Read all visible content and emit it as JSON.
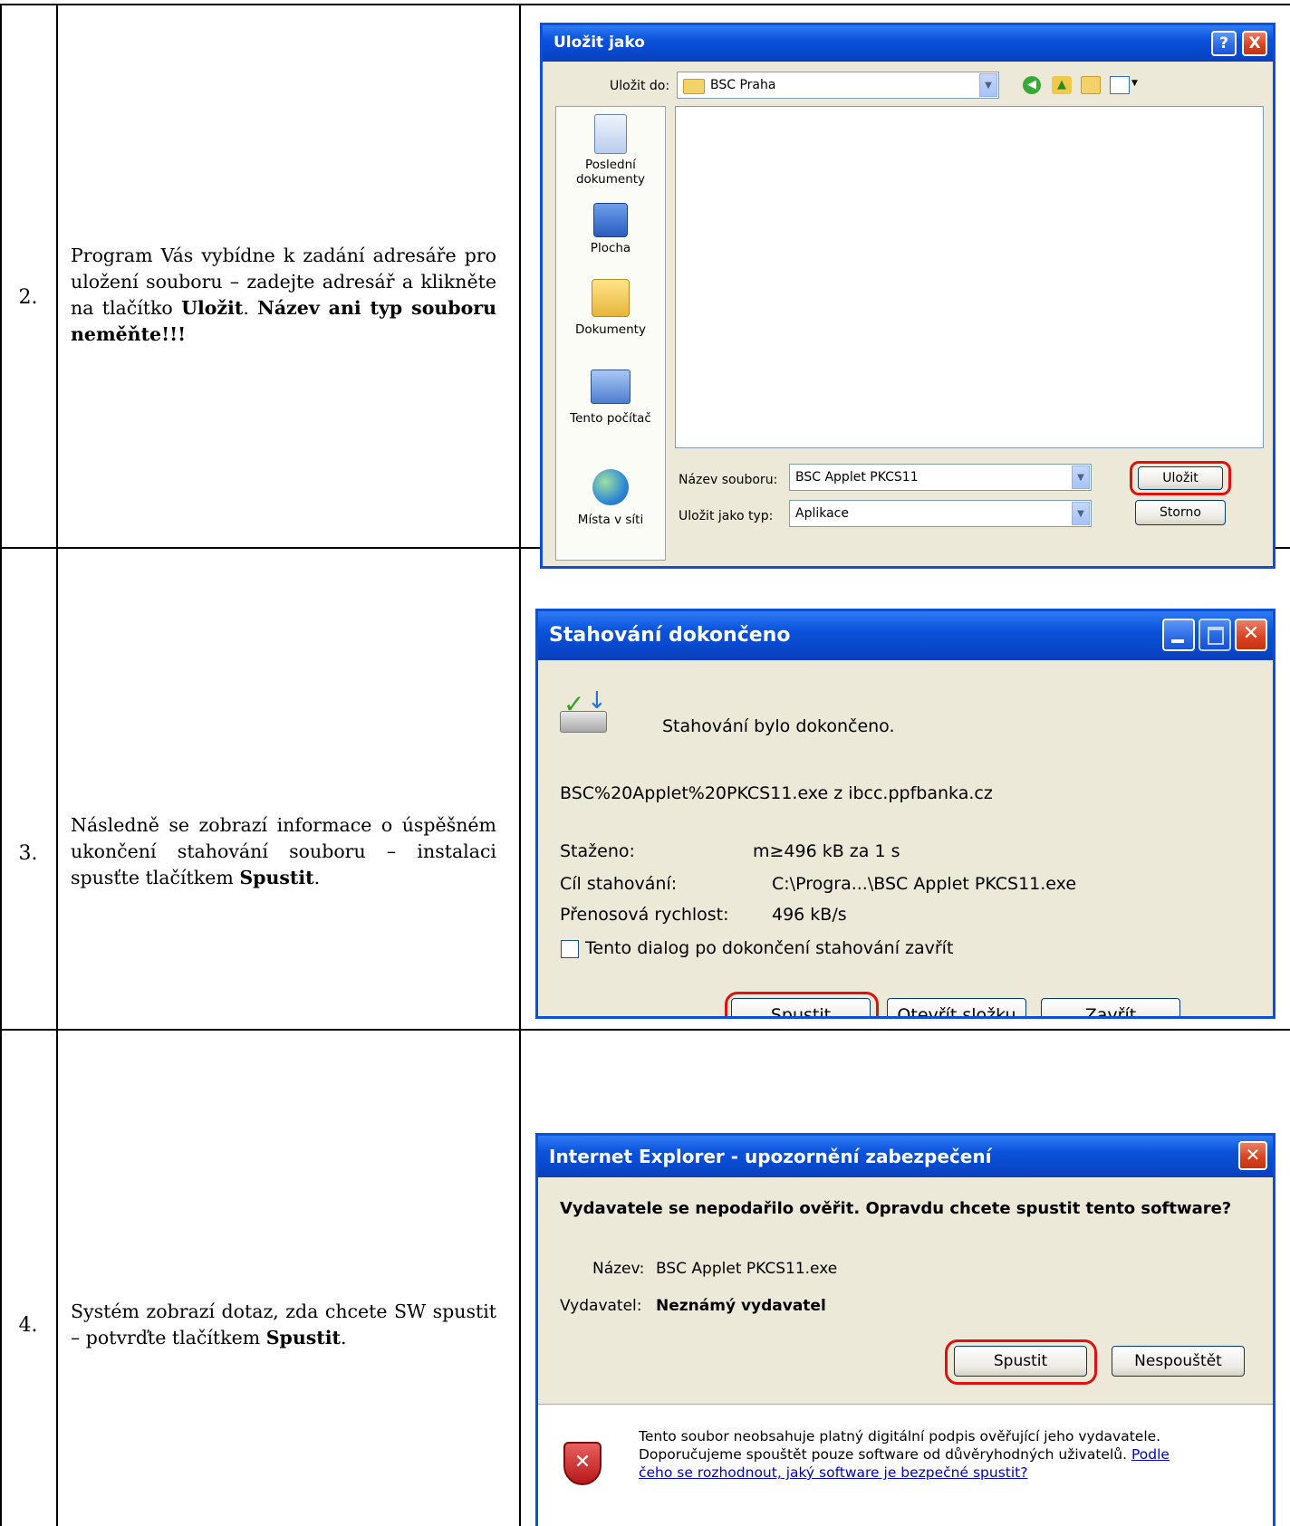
{
  "rows": [
    {
      "number": "2.",
      "text_plain": "Program Vás vybídne k zadání adresáře pro uložení souboru – zadejte adresář a klikněte na tlačítko",
      "text_bold1": "Uložit",
      "text_sep": ".",
      "text_bold2": "Název ani typ souboru neměňte!!!"
    },
    {
      "number": "3.",
      "text_plain": "Následně se zobrazí informace o úspěšném ukončení stahování souboru – instalaci spusťte tlačítkem",
      "text_bold": "Spustit",
      "text_end": "."
    },
    {
      "number": "4.",
      "text_plain": "Systém zobrazí dotaz, zda chcete SW spustit – potvrďte tlačítkem",
      "text_bold": "Spustit",
      "text_end": "."
    }
  ],
  "save_dialog": {
    "title": "Uložit jako",
    "help_button": "?",
    "close_button": "X",
    "save_in_label": "Uložit do:",
    "save_in_value": "BSC Praha",
    "places": [
      "Poslední dokumenty",
      "Plocha",
      "Dokumenty",
      "Tento počítač",
      "Místa v síti"
    ],
    "file_name_label": "Název souboru:",
    "file_name_value": "BSC Applet PKCS11",
    "file_type_label": "Uložit jako typ:",
    "file_type_value": "Aplikace",
    "save_button": "Uložit",
    "cancel_button": "Storno"
  },
  "download_dialog": {
    "title": "Stahování dokončeno",
    "message": "Stahování bylo dokončeno.",
    "source": "BSC%20Applet%20PKCS11.exe z ibcc.ppfbanka.cz",
    "downloaded_label": "Staženo:",
    "downloaded_value": "m≥496 kB za 1 s",
    "target_label": "Cíl stahování:",
    "target_value": "C:\\Progra...\\BSC Applet PKCS11.exe",
    "speed_label": "Přenosová rychlost:",
    "speed_value": "496 kB/s",
    "close_checkbox_label": "Tento dialog po dokončení stahování zavřít",
    "run_button": "Spustit",
    "open_folder_button": "Otevřít složku",
    "close_button_label": "Zavřít"
  },
  "security_dialog": {
    "title": "Internet Explorer - upozornění zabezpečení",
    "question": "Vydavatele se nepodařilo ověřit. Opravdu chcete spustit tento software?",
    "name_label": "Název:",
    "name_value": "BSC Applet PKCS11.exe",
    "publisher_label": "Vydavatel:",
    "publisher_value": "Neznámý vydavatel",
    "run_button": "Spustit",
    "dont_run_button": "Nespouštět",
    "warning_line1": "Tento soubor neobsahuje platný digitální podpis ověřující jeho vydavatele.",
    "warning_line2": "Doporučujeme spouštět pouze software od důvěryhodných uživatelů.",
    "warning_link1": "Podle",
    "warning_link2": "čeho se rozhodnout, jaký software je bezpečné spustit?"
  },
  "colors": {
    "xp_blue": "#0a50d8",
    "xp_face": "#ece9d8",
    "highlight_ring": "#e01010",
    "link": "#0000cc"
  }
}
